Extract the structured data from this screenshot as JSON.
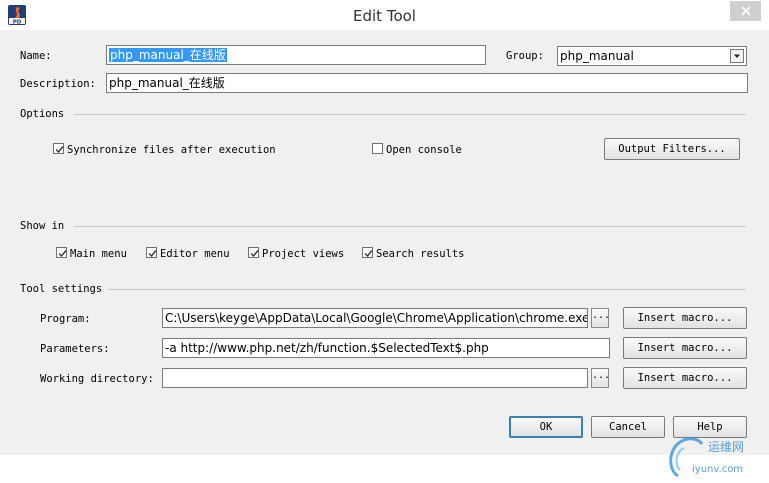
{
  "window": {
    "title": "Edit Tool"
  },
  "fields": {
    "name_label": "Name:",
    "name_value": "php_manual_在线版",
    "group_label": "Group:",
    "group_value": "php_manual",
    "description_label": "Description:",
    "description_value": "php_manual_在线版"
  },
  "options": {
    "heading": "Options",
    "sync_files": {
      "label": "Synchronize files after execution",
      "checked": true
    },
    "open_console": {
      "label": "Open console",
      "checked": false
    },
    "output_filters_button": "Output Filters..."
  },
  "show_in": {
    "heading": "Show in",
    "main_menu": {
      "label": "Main menu",
      "checked": true
    },
    "editor_menu": {
      "label": "Editor menu",
      "checked": true
    },
    "project_views": {
      "label": "Project views",
      "checked": true
    },
    "search_results": {
      "label": "Search results",
      "checked": true
    }
  },
  "tool_settings": {
    "heading": "Tool settings",
    "program_label": "Program:",
    "program_value": "C:\\Users\\keyge\\AppData\\Local\\Google\\Chrome\\Application\\chrome.exe",
    "parameters_label": "Parameters:",
    "parameters_value": "-a  http://www.php.net/zh/function.$SelectedText$.php",
    "working_dir_label": "Working directory:",
    "working_dir_value": "",
    "browse_label": "...",
    "insert_macro_button": "Insert macro..."
  },
  "buttons": {
    "ok": "OK",
    "cancel": "Cancel",
    "help": "Help"
  },
  "watermark": {
    "text_top": "运维网",
    "text_bottom": "iyunv.com"
  },
  "colors": {
    "selection": "#3399ff",
    "dialog_bg": "#f0f0f0",
    "ok_border": "#3c7fb1"
  }
}
